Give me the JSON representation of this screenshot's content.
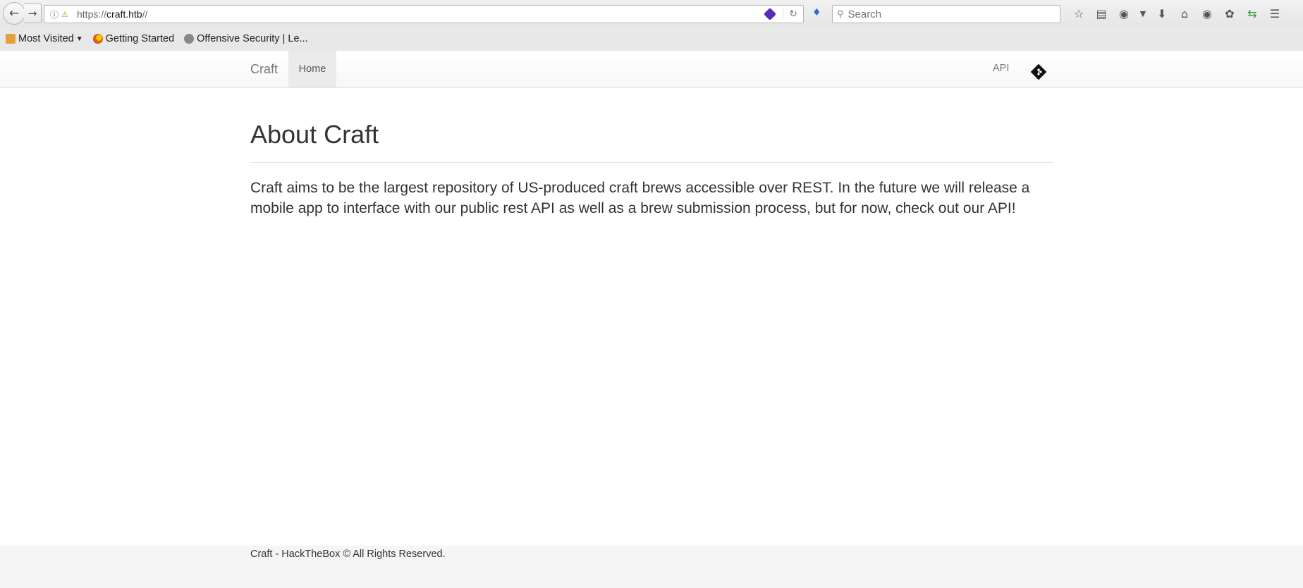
{
  "browser": {
    "url_prefix": "https://",
    "url_host": "craft.htb",
    "url_suffix": "//",
    "search_placeholder": "Search"
  },
  "bookmarks": [
    {
      "label": "Most Visited"
    },
    {
      "label": "Getting Started"
    },
    {
      "label": "Offensive Security | Le..."
    }
  ],
  "nav": {
    "brand": "Craft",
    "home": "Home",
    "api": "API"
  },
  "main": {
    "heading": "About Craft",
    "lead": "Craft aims to be the largest repository of US-produced craft brews accessible over REST. In the future we will release a mobile app to interface with our public rest API as well as a brew submission process, but for now, check out our API!"
  },
  "footer": {
    "text": "Craft - HackTheBox © All Rights Reserved."
  }
}
